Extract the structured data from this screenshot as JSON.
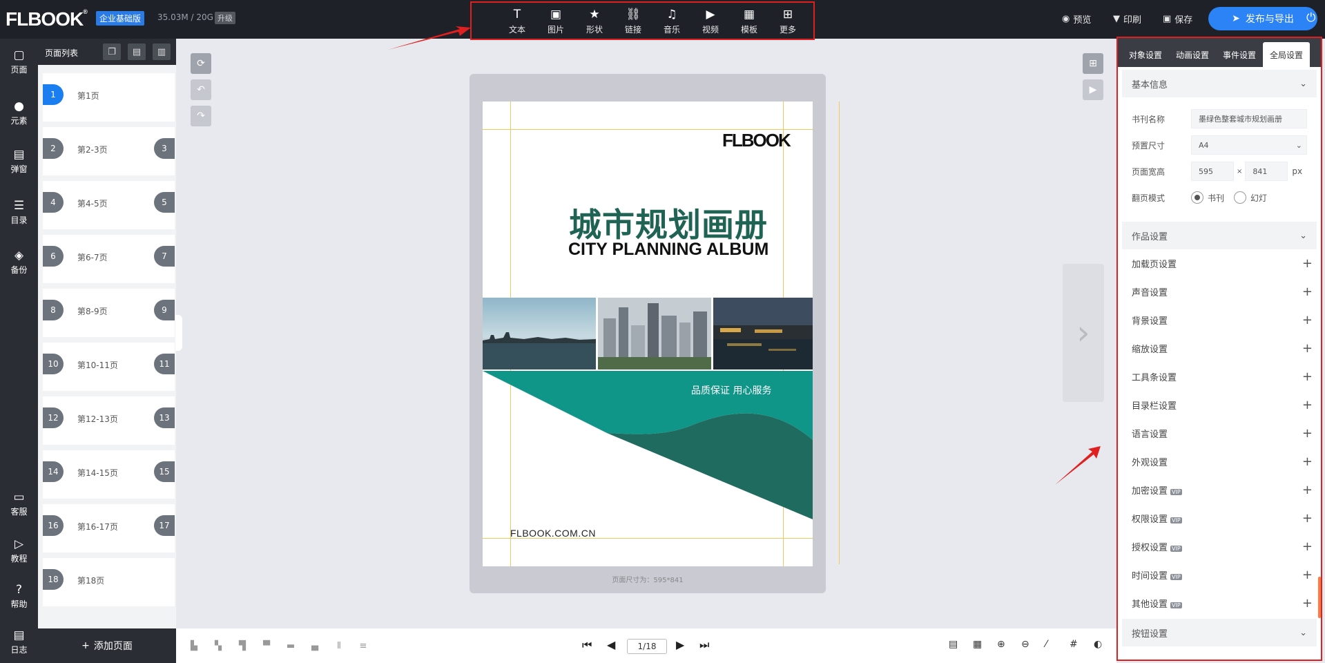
{
  "app": {
    "logo": "FLBOOK",
    "plan": "企业基础版",
    "storage": "35.03M / 20G",
    "upgrade": "升级"
  },
  "toolbar": [
    {
      "icon": "text-icon",
      "glyph": "T",
      "label": "文本"
    },
    {
      "icon": "image-icon",
      "glyph": "▣",
      "label": "图片"
    },
    {
      "icon": "star-icon",
      "glyph": "★",
      "label": "形状"
    },
    {
      "icon": "link-icon",
      "glyph": "⛓",
      "label": "链接"
    },
    {
      "icon": "music-icon",
      "glyph": "♫",
      "label": "音乐"
    },
    {
      "icon": "video-icon",
      "glyph": "▶",
      "label": "视频"
    },
    {
      "icon": "template-icon",
      "glyph": "▦",
      "label": "模板"
    },
    {
      "icon": "more-icon",
      "glyph": "⊞",
      "label": "更多"
    }
  ],
  "top_actions": {
    "preview": "预览",
    "print": "印刷",
    "save": "保存",
    "publish": "发布与导出"
  },
  "left_nav": [
    {
      "icon": "page-icon",
      "glyph": "▢",
      "label": "页面"
    },
    {
      "icon": "element-icon",
      "glyph": "●",
      "label": "元素"
    },
    {
      "icon": "popup-icon",
      "glyph": "▤",
      "label": "弹窗"
    },
    {
      "icon": "catalog-icon",
      "glyph": "☰",
      "label": "目录"
    },
    {
      "icon": "backup-icon",
      "glyph": "◈",
      "label": "备份"
    },
    {
      "icon": "support-icon",
      "glyph": "▭",
      "label": "客服"
    },
    {
      "icon": "tutorial-icon",
      "glyph": "▷",
      "label": "教程"
    },
    {
      "icon": "help-icon",
      "glyph": "?",
      "label": "帮助"
    },
    {
      "icon": "log-icon",
      "glyph": "▤",
      "label": "日志"
    }
  ],
  "page_list": {
    "title": "页面列表",
    "add_label": "添加页面",
    "pages": [
      {
        "left": "1",
        "name": "第1页",
        "right": ""
      },
      {
        "left": "2",
        "name": "第2-3页",
        "right": "3"
      },
      {
        "left": "4",
        "name": "第4-5页",
        "right": "5"
      },
      {
        "left": "6",
        "name": "第6-7页",
        "right": "7"
      },
      {
        "left": "8",
        "name": "第8-9页",
        "right": "9"
      },
      {
        "left": "10",
        "name": "第10-11页",
        "right": "11"
      },
      {
        "left": "12",
        "name": "第12-13页",
        "right": "13"
      },
      {
        "left": "14",
        "name": "第14-15页",
        "right": "15"
      },
      {
        "left": "16",
        "name": "第16-17页",
        "right": "17"
      },
      {
        "left": "18",
        "name": "第18页",
        "right": ""
      }
    ]
  },
  "canvas": {
    "logo": "FLBOOK",
    "title": "城市规划画册",
    "subtitle": "CITY PLANNING ALBUM",
    "slogan": "品质保证 用心服务",
    "url": "FLBOOK.COM.CN",
    "page_size": "页面尺寸为：595*841",
    "brand_green": "#1f6355",
    "teal": "#0f9688"
  },
  "right_panel": {
    "tabs": [
      "对象设置",
      "动画设置",
      "事件设置",
      "全局设置"
    ],
    "active_tab": "全局设置",
    "basic": {
      "title": "基本信息",
      "name_label": "书刊名称",
      "name_value": "墨绿色整套城市规划画册",
      "size_label": "预置尺寸",
      "size_value": "A4",
      "wh_label": "页面宽高",
      "width": "595",
      "times": "×",
      "height": "841",
      "unit": "px",
      "mode_label": "翻页模式",
      "mode_book": "书刊",
      "mode_slide": "幻灯"
    },
    "work_title": "作品设置",
    "items": [
      {
        "label": "加载页设置",
        "vip": ""
      },
      {
        "label": "声音设置",
        "vip": ""
      },
      {
        "label": "背景设置",
        "vip": ""
      },
      {
        "label": "缩放设置",
        "vip": ""
      },
      {
        "label": "工具条设置",
        "vip": ""
      },
      {
        "label": "目录栏设置",
        "vip": ""
      },
      {
        "label": "语言设置",
        "vip": ""
      },
      {
        "label": "外观设置",
        "vip": ""
      },
      {
        "label": "加密设置",
        "vip": "VIP"
      },
      {
        "label": "权限设置",
        "vip": "VIP"
      },
      {
        "label": "授权设置",
        "vip": "VIP"
      },
      {
        "label": "时间设置",
        "vip": "VIP"
      },
      {
        "label": "其他设置",
        "vip": "VIP"
      }
    ],
    "button_title": "按钮设置"
  },
  "pager": {
    "current": "1/18"
  }
}
